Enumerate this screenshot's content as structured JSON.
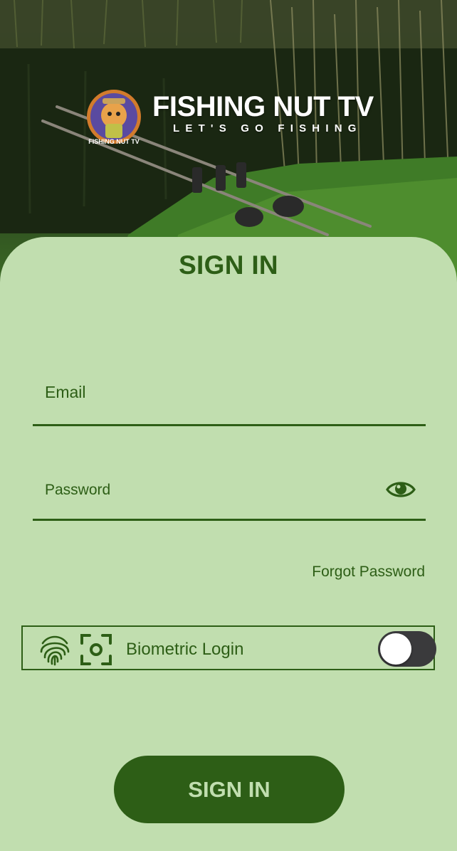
{
  "brand": {
    "title": "FISHING NUT TV",
    "tagline": "LET'S GO FISHING",
    "badge_text": "FISHING NUT TV"
  },
  "signin": {
    "heading": "SIGN IN",
    "email_placeholder": "Email",
    "password_placeholder": "Password",
    "forgot_label": "Forgot Password",
    "biometric_label": "Biometric Login",
    "biometric_enabled": false,
    "submit_label": "SIGN IN"
  },
  "colors": {
    "accent": "#2d5e16",
    "sheet": "#c1deaf",
    "toggle_off": "#3a3a3c"
  },
  "icons": {
    "password_toggle": "eye-icon",
    "biometric_fingerprint": "fingerprint-icon",
    "biometric_face": "face-id-icon"
  }
}
